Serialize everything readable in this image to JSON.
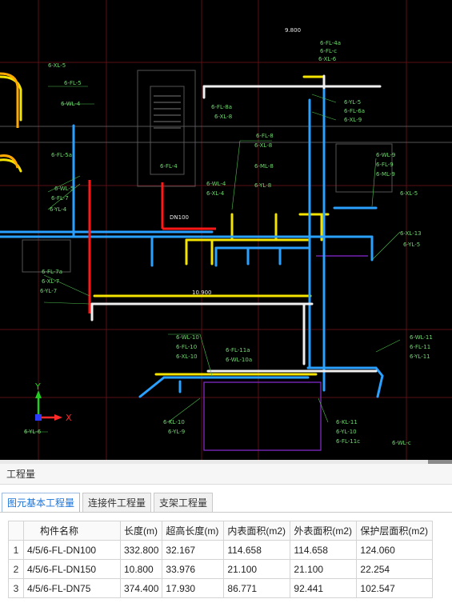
{
  "drawing": {
    "labels_top": [
      "6-FL-4a",
      "6-FL-c",
      "6-XL-6",
      "6-FL-8a",
      "6-XL-8",
      "6-YL-5",
      "6-FL-6a",
      "6-XL-9"
    ],
    "labels_left": [
      "6-XL-5",
      "6-FL-5",
      "6-WL-4",
      "6-FL-5a",
      "6-WL-5",
      "6-FL-7",
      "6-YL-4",
      "6-FL-7a",
      "6-XL-7",
      "6-YL-7",
      "6-YL-6"
    ],
    "labels_mid": [
      "6-FL-8",
      "6-XL-8",
      "6-ML-8",
      "6-YL-8",
      "6-FL-4",
      "6-WL-4",
      "6-XL-4",
      "6-WL-10",
      "6-FL-10",
      "6-XL-10",
      "6-FL-11a",
      "6-WL-10a",
      "6-KL-10",
      "6-YL-9"
    ],
    "labels_right": [
      "6-WL-9",
      "6-FL-9",
      "6-ML-9",
      "6-XL-5",
      "6-XL-13",
      "6-YL-5",
      "6-WL-11",
      "6-FL-11",
      "6-YL-11",
      "6-KL-11",
      "6-YL-10",
      "6-FL-11c",
      "6-WL-c"
    ],
    "elevation_top": "9.800",
    "elevation_mid": "10.900",
    "dn_label": "DN100",
    "axis_x": "X",
    "axis_y": "Y"
  },
  "panel": {
    "title": "工程量",
    "tabs": [
      "图元基本工程量",
      "连接件工程量",
      "支架工程量"
    ],
    "active_tab": 0,
    "columns": [
      "",
      "构件名称",
      "长度(m)",
      "超高长度(m)",
      "内表面积(m2)",
      "外表面积(m2)",
      "保护层面积(m2)"
    ],
    "rows": [
      [
        "1",
        "4/5/6-FL-DN100",
        "332.800",
        "32.167",
        "114.658",
        "114.658",
        "124.060"
      ],
      [
        "2",
        "4/5/6-FL-DN150",
        "10.800",
        "33.976",
        "21.100",
        "21.100",
        "22.254"
      ],
      [
        "3",
        "4/5/6-FL-DN75",
        "374.400",
        "17.930",
        "86.771",
        "92.441",
        "102.547"
      ]
    ]
  }
}
